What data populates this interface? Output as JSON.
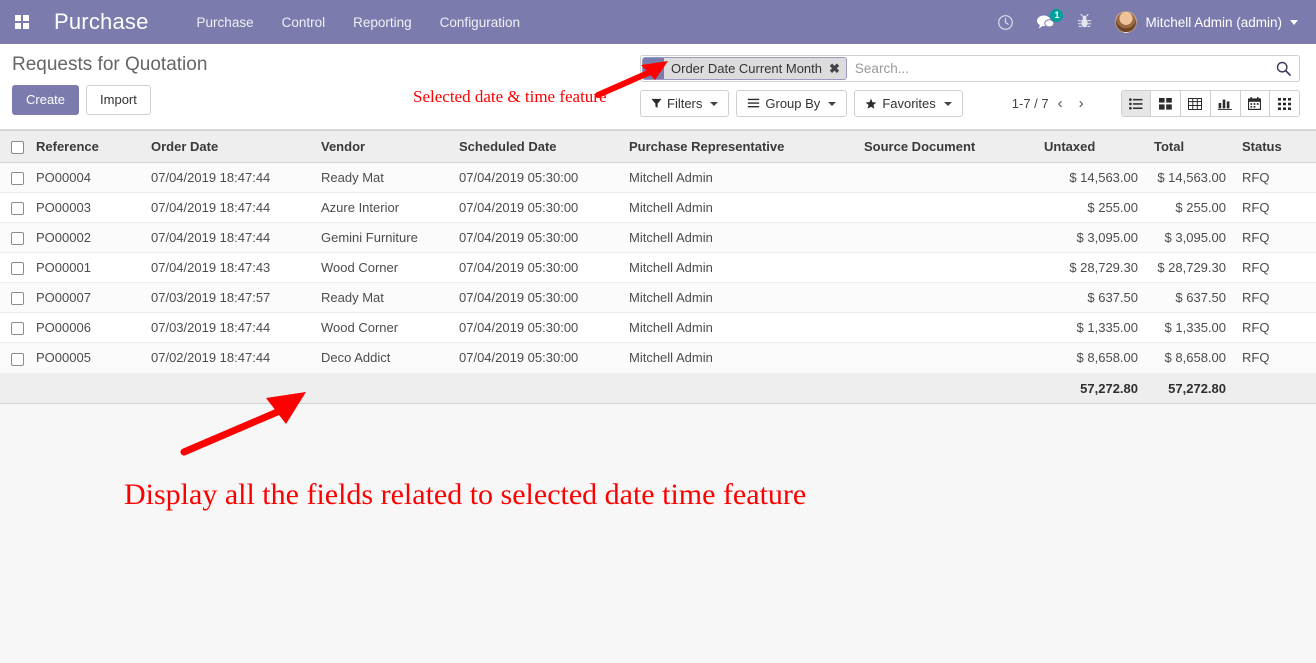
{
  "navbar": {
    "apps_icon": "apps-grid-icon",
    "brand": "Purchase",
    "menu": [
      {
        "label": "Purchase"
      },
      {
        "label": "Control"
      },
      {
        "label": "Reporting"
      },
      {
        "label": "Configuration"
      }
    ],
    "icons": {
      "activity": "clock-icon",
      "messages": "chat-bubble-icon",
      "messages_badge": "1",
      "debug": "bug-icon"
    },
    "user": {
      "name": "Mitchell Admin (admin)",
      "avatar": "user-avatar"
    },
    "background_color": "#7c7bad"
  },
  "control_panel": {
    "title": "Requests for Quotation",
    "buttons": {
      "create": "Create",
      "import": "Import"
    },
    "search": {
      "facet_label": "Order Date Current Month",
      "facet_icon": "filter-funnel-icon",
      "facet_remove": "✖",
      "placeholder": "Search...",
      "value": ""
    },
    "dropdowns": [
      {
        "label": "Filters",
        "icon": "filter-funnel-icon"
      },
      {
        "label": "Group By",
        "icon": "hamburger-lines-icon"
      },
      {
        "label": "Favorites",
        "icon": "star-icon"
      }
    ],
    "pager": {
      "count": "1-7 / 7",
      "previous": "‹",
      "next": "›"
    },
    "views": [
      {
        "name": "list-view",
        "active": true
      },
      {
        "name": "kanban-view",
        "active": false
      },
      {
        "name": "pivot-view",
        "active": false
      },
      {
        "name": "graph-view",
        "active": false
      },
      {
        "name": "calendar-view",
        "active": false
      },
      {
        "name": "activity-view",
        "active": false
      }
    ]
  },
  "list": {
    "columns": [
      "Reference",
      "Order Date",
      "Vendor",
      "Scheduled Date",
      "Purchase Representative",
      "Source Document",
      "Untaxed",
      "Total",
      "Status"
    ],
    "rows": [
      {
        "reference": "PO00004",
        "order_date": "07/04/2019 18:47:44",
        "vendor": "Ready Mat",
        "scheduled_date": "07/04/2019 05:30:00",
        "purchase_representative": "Mitchell Admin",
        "source_document": "",
        "untaxed": "$ 14,563.00",
        "total": "$ 14,563.00",
        "status": "RFQ"
      },
      {
        "reference": "PO00003",
        "order_date": "07/04/2019 18:47:44",
        "vendor": "Azure Interior",
        "scheduled_date": "07/04/2019 05:30:00",
        "purchase_representative": "Mitchell Admin",
        "source_document": "",
        "untaxed": "$ 255.00",
        "total": "$ 255.00",
        "status": "RFQ"
      },
      {
        "reference": "PO00002",
        "order_date": "07/04/2019 18:47:44",
        "vendor": "Gemini Furniture",
        "scheduled_date": "07/04/2019 05:30:00",
        "purchase_representative": "Mitchell Admin",
        "source_document": "",
        "untaxed": "$ 3,095.00",
        "total": "$ 3,095.00",
        "status": "RFQ"
      },
      {
        "reference": "PO00001",
        "order_date": "07/04/2019 18:47:43",
        "vendor": "Wood Corner",
        "scheduled_date": "07/04/2019 05:30:00",
        "purchase_representative": "Mitchell Admin",
        "source_document": "",
        "untaxed": "$ 28,729.30",
        "total": "$ 28,729.30",
        "status": "RFQ"
      },
      {
        "reference": "PO00007",
        "order_date": "07/03/2019 18:47:57",
        "vendor": "Ready Mat",
        "scheduled_date": "07/04/2019 05:30:00",
        "purchase_representative": "Mitchell Admin",
        "source_document": "",
        "untaxed": "$ 637.50",
        "total": "$ 637.50",
        "status": "RFQ"
      },
      {
        "reference": "PO00006",
        "order_date": "07/03/2019 18:47:44",
        "vendor": "Wood Corner",
        "scheduled_date": "07/04/2019 05:30:00",
        "purchase_representative": "Mitchell Admin",
        "source_document": "",
        "untaxed": "$ 1,335.00",
        "total": "$ 1,335.00",
        "status": "RFQ"
      },
      {
        "reference": "PO00005",
        "order_date": "07/02/2019 18:47:44",
        "vendor": "Deco Addict",
        "scheduled_date": "07/04/2019 05:30:00",
        "purchase_representative": "Mitchell Admin",
        "source_document": "",
        "untaxed": "$ 8,658.00",
        "total": "$ 8,658.00",
        "status": "RFQ"
      }
    ],
    "totals": {
      "untaxed": "57,272.80",
      "total": "57,272.80"
    }
  },
  "annotations": {
    "top": "Selected date & time feature",
    "bottom": "Display all the fields related to selected date time feature",
    "color": "#ff0000"
  }
}
